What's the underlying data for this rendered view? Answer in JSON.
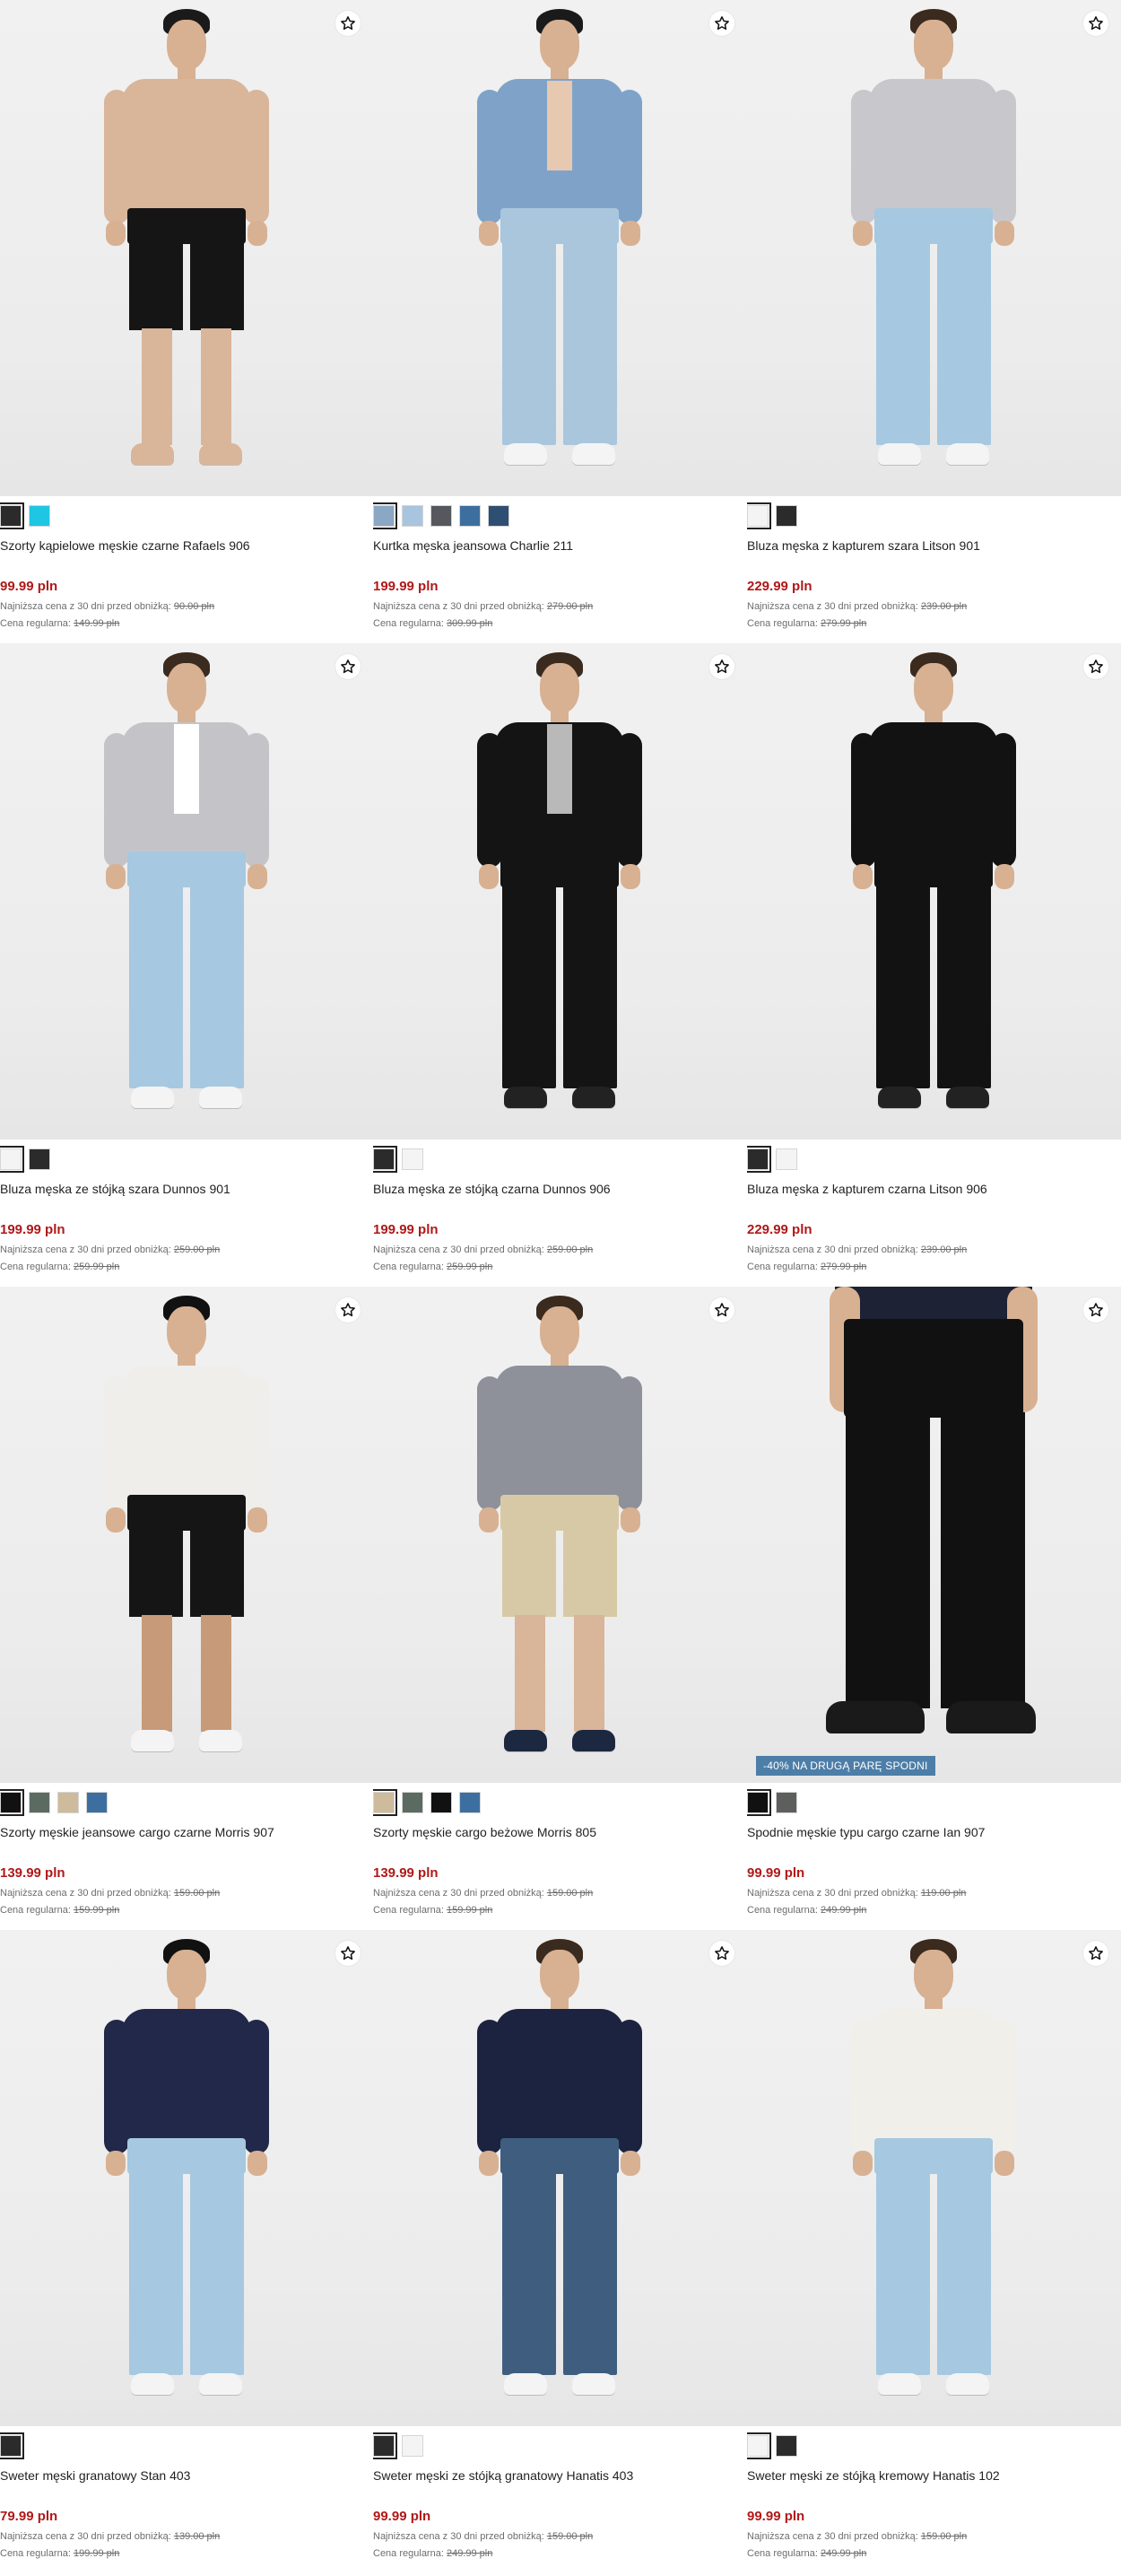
{
  "labels": {
    "lowest_price_prefix": "Najniższa cena z 30 dni przed obniżką:",
    "regular_price_prefix": "Cena regularna:"
  },
  "products": [
    {
      "name": "Szorty kąpielowe męskie czarne Rafaels 906",
      "price": "99.99 pln",
      "lowest_price": "90.00 pln",
      "regular_price": "149.99 pln",
      "swatches": [
        "#2b2b2b",
        "#1ec6e3"
      ],
      "selected": 0,
      "promo": "",
      "look": {
        "skin_top": true,
        "top": "#d9b59a",
        "sleeve": "#d9b59a",
        "bottom": "#151515",
        "bottom_len": "short",
        "legs": "#d9b59a",
        "shoes": "#d9b59a",
        "hair": "#1a1a1a"
      }
    },
    {
      "name": "Kurtka męska jeansowa Charlie 211",
      "price": "199.99 pln",
      "lowest_price": "279.00 pln",
      "regular_price": "309.99 pln",
      "swatches": [
        "#8aa7c4",
        "#a9c4df",
        "#55585c",
        "#3d6ea0",
        "#2f4f72"
      ],
      "selected": 0,
      "promo": "",
      "look": {
        "skin_top": false,
        "top": "#7fa3c8",
        "sleeve": "#7fa3c8",
        "inner": "#e7c8b0",
        "bottom": "#a9c6dd",
        "bottom_len": "long",
        "legs": "#a9c6dd",
        "shoes": "#f4f4f4",
        "hair": "#1a1a1a"
      }
    },
    {
      "name": "Bluza męska z kapturem szara Litson 901",
      "price": "229.99 pln",
      "lowest_price": "239.00 pln",
      "regular_price": "279.99 pln",
      "swatches": [
        "#f4f4f4",
        "#2b2b2b"
      ],
      "selected": 0,
      "promo": "",
      "look": {
        "skin_top": false,
        "top": "#c8c8cc",
        "sleeve": "#c8c8cc",
        "bottom": "#a6c8e0",
        "bottom_len": "long",
        "legs": "#a6c8e0",
        "shoes": "#f4f4f4",
        "hair": "#3b2a1e"
      }
    },
    {
      "name": "Bluza męska ze stójką szara Dunnos 901",
      "price": "199.99 pln",
      "lowest_price": "259.00 pln",
      "regular_price": "259.99 pln",
      "swatches": [
        "#f4f4f4",
        "#2b2b2b"
      ],
      "selected": 0,
      "promo": "",
      "look": {
        "skin_top": false,
        "top": "#c4c4c8",
        "sleeve": "#c4c4c8",
        "inner": "#ffffff",
        "bottom": "#a6c8e0",
        "bottom_len": "long",
        "legs": "#a6c8e0",
        "shoes": "#f4f4f4",
        "hair": "#3b2a1e"
      }
    },
    {
      "name": "Bluza męska ze stójką czarna Dunnos 906",
      "price": "199.99 pln",
      "lowest_price": "259.00 pln",
      "regular_price": "259.99 pln",
      "swatches": [
        "#2b2b2b",
        "#f4f4f4"
      ],
      "selected": 0,
      "promo": "",
      "look": {
        "skin_top": false,
        "top": "#141414",
        "sleeve": "#141414",
        "inner": "#b9b9b9",
        "bottom": "#141414",
        "bottom_len": "long",
        "legs": "#141414",
        "shoes": "#222222",
        "hair": "#3b2a1e"
      }
    },
    {
      "name": "Bluza męska z kapturem czarna Litson 906",
      "price": "229.99 pln",
      "lowest_price": "239.00 pln",
      "regular_price": "279.99 pln",
      "swatches": [
        "#2b2b2b",
        "#f4f4f4"
      ],
      "selected": 0,
      "promo": "",
      "look": {
        "skin_top": false,
        "top": "#121212",
        "sleeve": "#121212",
        "bottom": "#121212",
        "bottom_len": "long",
        "legs": "#121212",
        "shoes": "#222222",
        "hair": "#3b2a1e"
      }
    },
    {
      "name": "Szorty męskie jeansowe cargo czarne Morris 907",
      "price": "139.99 pln",
      "lowest_price": "159.00 pln",
      "regular_price": "159.99 pln",
      "swatches": [
        "#111111",
        "#5b6b62",
        "#cdbb9c",
        "#3d6ea0"
      ],
      "selected": 0,
      "promo": "",
      "look": {
        "skin_top": false,
        "top": "#f0eeea",
        "sleeve": "#f0eeea",
        "bottom": "#151515",
        "bottom_len": "short",
        "legs": "#c79a7a",
        "shoes": "#f4f4f4",
        "hair": "#111111"
      }
    },
    {
      "name": "Szorty męskie cargo beżowe Morris 805",
      "price": "139.99 pln",
      "lowest_price": "159.00 pln",
      "regular_price": "159.99 pln",
      "swatches": [
        "#cdbb9c",
        "#5b6b62",
        "#111111",
        "#3d6ea0"
      ],
      "selected": 0,
      "promo": "",
      "look": {
        "skin_top": false,
        "top": "#8e9199",
        "sleeve": "#8e9199",
        "bottom": "#d8c9a6",
        "bottom_len": "short",
        "legs": "#d9b59a",
        "shoes": "#1c2740",
        "hair": "#3b2a1e"
      }
    },
    {
      "name": "Spodnie męskie typu cargo czarne Ian 907",
      "price": "99.99 pln",
      "lowest_price": "119.00 pln",
      "regular_price": "249.99 pln",
      "swatches": [
        "#111111",
        "#5c5f5c"
      ],
      "selected": 0,
      "promo": "-40% NA DRUGĄ PARĘ SPODNI",
      "look": {
        "skin_top": false,
        "top": "#1d2235",
        "sleeve": "#1d2235",
        "bottom": "#111111",
        "bottom_len": "long",
        "legs": "#111111",
        "shoes": "#1a1a1a",
        "hair": "#111111",
        "cropped": true
      }
    },
    {
      "name": "Sweter męski granatowy Stan 403",
      "price": "79.99 pln",
      "lowest_price": "139.00 pln",
      "regular_price": "199.99 pln",
      "swatches": [
        "#2b2b2b"
      ],
      "selected": 0,
      "promo": "",
      "look": {
        "skin_top": false,
        "top": "#22284a",
        "sleeve": "#22284a",
        "bottom": "#a6c8e0",
        "bottom_len": "long",
        "legs": "#a6c8e0",
        "shoes": "#f4f4f4",
        "hair": "#111111"
      }
    },
    {
      "name": "Sweter męski ze stójką granatowy Hanatis 403",
      "price": "99.99 pln",
      "lowest_price": "159.00 pln",
      "regular_price": "249.99 pln",
      "swatches": [
        "#2b2b2b",
        "#f4f4f4"
      ],
      "selected": 0,
      "promo": "",
      "look": {
        "skin_top": false,
        "top": "#1c2340",
        "sleeve": "#1c2340",
        "bottom": "#3f5e7f",
        "bottom_len": "long",
        "legs": "#3f5e7f",
        "shoes": "#f4f4f4",
        "hair": "#3b2a1e"
      }
    },
    {
      "name": "Sweter męski ze stójką kremowy Hanatis 102",
      "price": "99.99 pln",
      "lowest_price": "159.00 pln",
      "regular_price": "249.99 pln",
      "swatches": [
        "#f4f4f4",
        "#2b2b2b"
      ],
      "selected": 0,
      "promo": "",
      "look": {
        "skin_top": false,
        "top": "#f1efea",
        "sleeve": "#f1efea",
        "bottom": "#a6c8e0",
        "bottom_len": "long",
        "legs": "#a6c8e0",
        "shoes": "#f4f4f4",
        "hair": "#3b2a1e"
      }
    }
  ]
}
